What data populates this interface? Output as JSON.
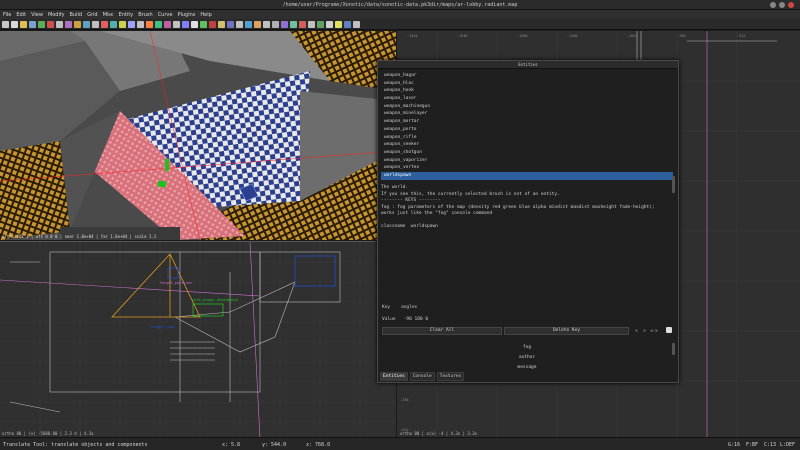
{
  "window": {
    "title": "/home/user/Programs/Xonotic/data/xonotic-data.pk3dir/maps/ar-lobby.radiant.map"
  },
  "menu": [
    "File",
    "Edit",
    "View",
    "Modify",
    "Build",
    "Grid",
    "Misc",
    "Entity",
    "Brush",
    "Curve",
    "Plugins",
    "Help"
  ],
  "toolbar_colors": [
    "#c8c8c8",
    "#d9d9d9",
    "#e0c050",
    "#7aa0d0",
    "#5ab05a",
    "#d05050",
    "#c0c0c0",
    "#b070c0",
    "#d0a040",
    "#60a0c0",
    "#c0c0c0",
    "#e06060",
    "#50b0b0",
    "#d0d050",
    "#a0a0ff",
    "#c0c0c0",
    "#ff8040",
    "#40c080",
    "#c060a0",
    "#c0c0c0",
    "#8080ff",
    "#e0e0e0",
    "#60c060",
    "#c04040",
    "#d0c070",
    "#7070c0",
    "#c0c0c0",
    "#50a0d0",
    "#e0a060",
    "#c0c0c0",
    "#b0b0b0",
    "#9070d0",
    "#70c0a0",
    "#d06060",
    "#c0c0c0",
    "#60a060",
    "#d0d0d0",
    "#e0e060",
    "#6080c0",
    "#c0c0c0"
  ],
  "view3d": {
    "status": "ortho FOV 1 | ofs 0 0 0 | near 1.0e+04 | far 1.6e+04 | scale 1.1"
  },
  "view2d": {
    "status": "ortho 80 | (x)  -5888.00 | 2.3 d | 4.3x"
  },
  "viewside": {
    "status": "ortho 80 | x(x)  -4 | 4.3x | 3.3x"
  },
  "entity_window": {
    "title": "Entities",
    "entities": [
      "weapon_hagar",
      "weapon_hlac",
      "weapon_hook",
      "weapon_laser",
      "weapon_machinegun",
      "weapon_minelayer",
      "weapon_mortar",
      "weapon_porto",
      "weapon_rifle",
      "weapon_seeker",
      "weapon_shotgun",
      "weapon_vaporizer",
      "weapon_vortex",
      "worldspawn"
    ],
    "selected_index": 13,
    "desc_lines": [
      "The world.",
      "If you see this, the currently selected brush is not of an entity.",
      "-------- KEYS --------",
      "fog : fog parameters of the map (density red green blue alpha mindist maxdist maxheight fade-height);",
      "works just like the \"fog\" console command",
      "",
      "classname  worldspawn"
    ],
    "key_label": "Key",
    "key_value": "angles",
    "val_label": "Value",
    "val_value": "-90 180 0",
    "clear_all": "Clear All",
    "delete_key": "Delete Key",
    "small_btns": [
      "<",
      ">",
      "<->"
    ],
    "props": [
      "fog",
      "author",
      "message"
    ],
    "tabs": [
      "Entities",
      "Console",
      "Textures"
    ]
  },
  "statusbar": {
    "hint": "Translate Tool: translate objects and components",
    "x": "x:   5.8",
    "y": "y:   544.0",
    "z": "z:   768.0",
    "grid": "G:16",
    "f": "F:BF",
    "c": "C:13",
    "l": "L:DEF"
  },
  "colors": {
    "accent_selection": "#2d5f9e",
    "checker_blue": "#2c3f8f",
    "brush_red": "#d8707a"
  }
}
